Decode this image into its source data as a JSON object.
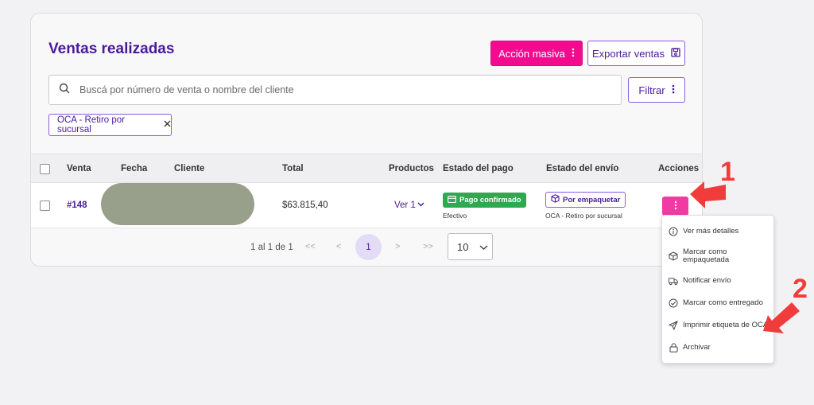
{
  "page": {
    "title": "Ventas realizadas"
  },
  "toolbar": {
    "mass_action_label": "Acción masiva",
    "export_label": "Exportar ventas",
    "filter_label": "Filtrar"
  },
  "search": {
    "placeholder": "Buscá por número de venta o nombre del cliente"
  },
  "active_filter": {
    "label": "OCA - Retiro por sucursal"
  },
  "table": {
    "headers": [
      "Venta",
      "Fecha",
      "Cliente",
      "Total",
      "Productos",
      "Estado del pago",
      "Estado del envío",
      "Acciones"
    ],
    "rows": [
      {
        "sale": "#148",
        "date": "",
        "client": "",
        "total": "$63.815,40",
        "products": "Ver 1",
        "payment_status": "Pago confirmado",
        "payment_method": "Efectivo",
        "shipping_status": "Por empaquetar",
        "shipping_method": "OCA - Retiro por sucursal"
      }
    ]
  },
  "pagination": {
    "range_label": "1 al 1 de 1",
    "first": "<<",
    "prev": "<",
    "current": "1",
    "next": ">",
    "last": ">>",
    "per_page": "10"
  },
  "actions_menu": {
    "items": [
      {
        "label": "Ver más detalles",
        "icon": "info-icon"
      },
      {
        "label": "Marcar como empaquetada",
        "icon": "box-icon"
      },
      {
        "label": "Notificar envío",
        "icon": "truck-icon"
      },
      {
        "label": "Marcar como entregado",
        "icon": "check-circle-icon"
      },
      {
        "label": "Imprimir etiqueta de OCA",
        "icon": "send-icon"
      },
      {
        "label": "Archivar",
        "icon": "lock-icon"
      }
    ]
  },
  "annotations": {
    "step1": "1",
    "step2": "2"
  },
  "colors": {
    "brand_purple": "#4a1a9c",
    "accent_pink": "#f20b8e",
    "success_green": "#2fa84f",
    "annotation_red": "#f13c3c"
  }
}
